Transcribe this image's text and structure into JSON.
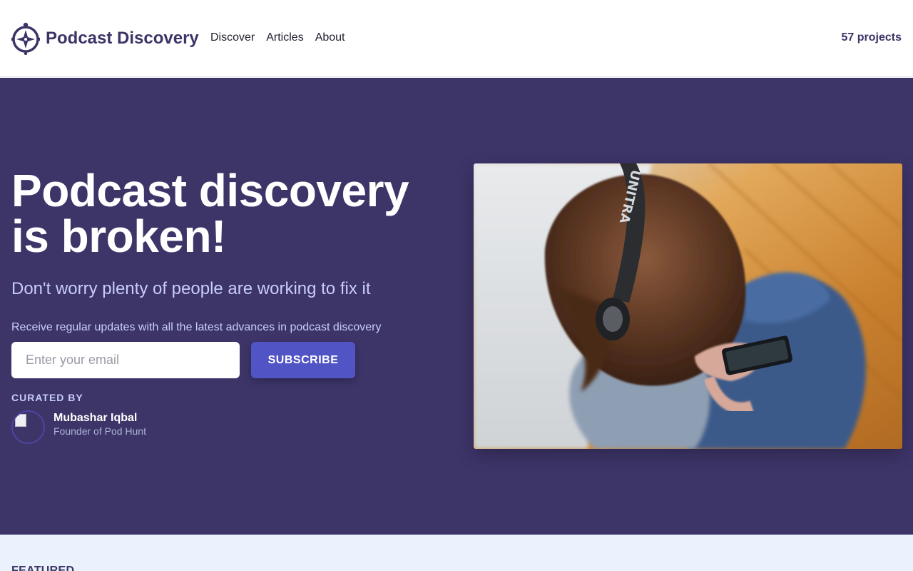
{
  "header": {
    "brand_name": "Podcast Discovery",
    "logo_icon": "compass-icon",
    "nav": [
      {
        "label": "Discover"
      },
      {
        "label": "Articles"
      },
      {
        "label": "About"
      }
    ],
    "projects_count": "57 projects"
  },
  "hero": {
    "title": "Podcast discovery is broken!",
    "subtitle": "Don't worry plenty of people are working to fix it",
    "updates_text": "Receive regular updates with all the latest advances in podcast discovery",
    "email_placeholder": "Enter your email",
    "email_value": "",
    "subscribe_label": "SUBSCRIBE",
    "curated_label": "CURATED BY",
    "curator": {
      "name": "Mubashar Iqbal",
      "role": "Founder of Pod Hunt"
    },
    "photo_headphone_brand": "UNITRA"
  },
  "featured": {
    "label": "FEATURED"
  },
  "colors": {
    "hero_bg": "#3d3468",
    "brand": "#3d3466",
    "accent_button": "#5054c4",
    "featured_bg": "#e9f2fd",
    "subtitle_text": "#c8cdfa"
  }
}
